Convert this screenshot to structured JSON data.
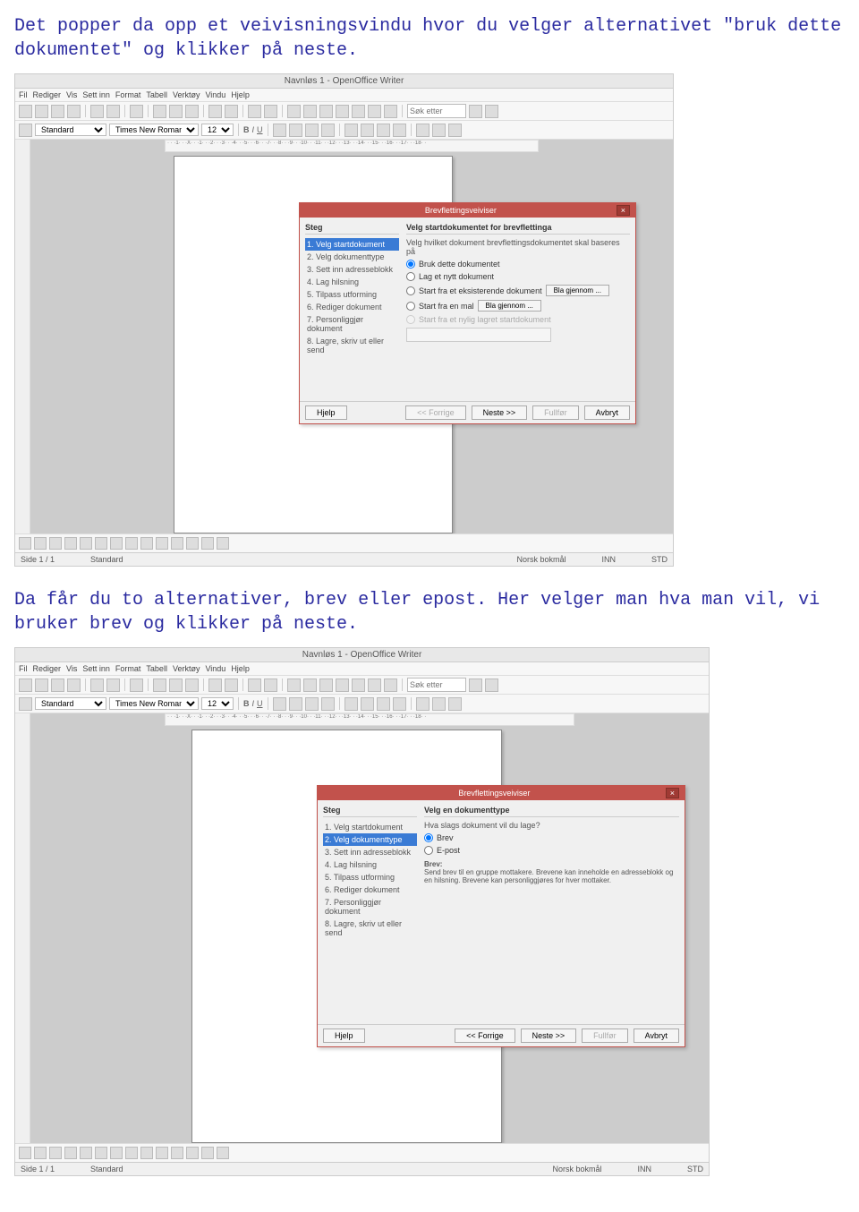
{
  "intro1": "Det popper da opp et veivisningsvindu hvor du velger alternativet \"bruk dette dokumentet\" og klikker på neste.",
  "intro2": "Da får du to alternativer, brev eller epost. Her velger man hva man vil, vi bruker brev og klikker på neste.",
  "app": {
    "title": "Navnløs 1 - OpenOffice Writer",
    "menu": [
      "Fil",
      "Rediger",
      "Vis",
      "Sett inn",
      "Format",
      "Tabell",
      "Verktøy",
      "Vindu",
      "Hjelp"
    ],
    "style": "Standard",
    "font": "Times New Roman",
    "size": "12",
    "search_placeholder": "Søk etter",
    "ruler": "· · ·1· · ·X· · ·1· · ·2· · ·3· · ·4· · ·5· · ·6· · ·7· · ·8· · ·9· · ·10· · ·11· · ·12· · ·13· · ·14· · ·15· · ·16· · ·17· · ·18· ·",
    "status": {
      "page": "Side 1 / 1",
      "style": "Standard",
      "lang": "Norsk bokmål",
      "mode1": "INN",
      "mode2": "STD"
    }
  },
  "dialog": {
    "title": "Brevflettingsveiviser",
    "steps_header": "Steg",
    "steps": [
      "1. Velg startdokument",
      "2. Velg dokumenttype",
      "3. Sett inn adresseblokk",
      "4. Lag hilsning",
      "5. Tilpass utforming",
      "6. Rediger dokument",
      "7. Personliggjør dokument",
      "8. Lagre, skriv ut eller send"
    ],
    "buttons": {
      "help": "Hjelp",
      "back": "<< Forrige",
      "next": "Neste >>",
      "finish": "Fullfør",
      "cancel": "Avbryt"
    }
  },
  "step1": {
    "header": "Velg startdokumentet for brevflettinga",
    "sub": "Velg hvilket dokument brevflettingsdokumentet skal baseres på",
    "options": [
      "Bruk dette dokumentet",
      "Lag et nytt dokument",
      "Start fra et eksisterende dokument",
      "Start fra en mal",
      "Start fra et nylig lagret startdokument"
    ],
    "browse": "Bla gjennom ..."
  },
  "step2": {
    "header": "Velg en dokumenttype",
    "sub": "Hva slags dokument vil du lage?",
    "options": [
      "Brev",
      "E-post"
    ],
    "desc_title": "Brev:",
    "desc": "Send brev til en gruppe mottakere. Brevene kan inneholde en adresseblokk og en hilsning. Brevene kan personliggjøres for hver mottaker."
  }
}
